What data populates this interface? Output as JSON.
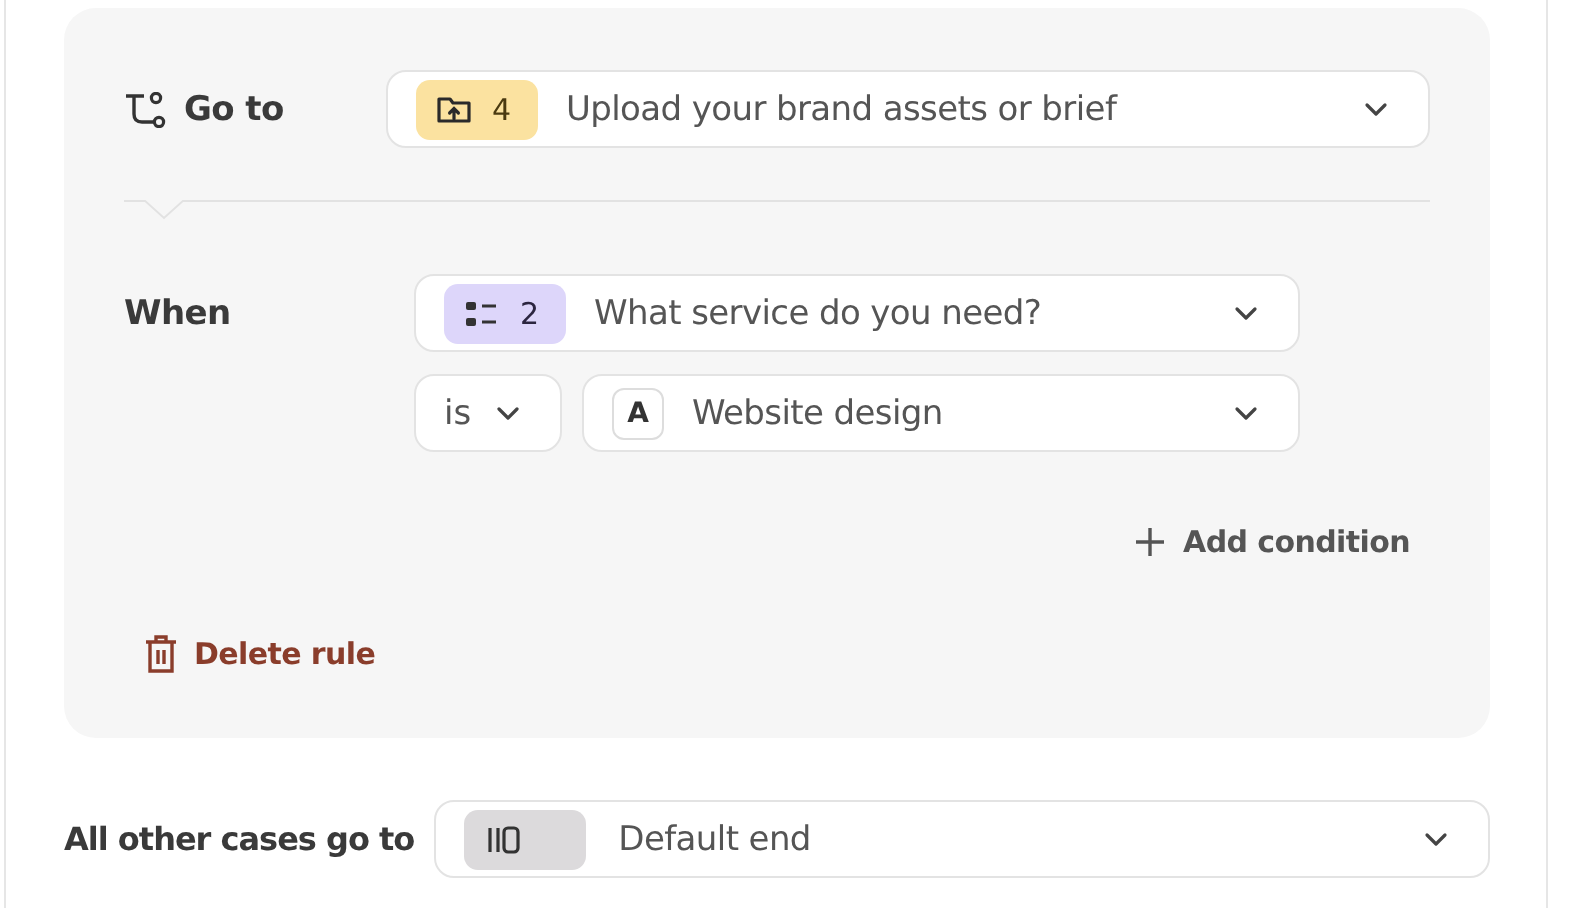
{
  "rule": {
    "go_to": {
      "label": "Go to",
      "target": {
        "kind": "upload",
        "number": "4",
        "text": "Upload your brand assets or brief"
      }
    },
    "when": {
      "label": "When",
      "conditions": [
        {
          "question": {
            "kind": "choice",
            "number": "2",
            "text": "What service do you need?"
          },
          "operator": "is",
          "value": {
            "key": "A",
            "text": "Website design"
          }
        }
      ]
    },
    "add_condition": "Add condition",
    "delete": "Delete rule"
  },
  "fallback": {
    "label": "All other cases go to",
    "target": {
      "kind": "end",
      "text": "Default end"
    }
  }
}
